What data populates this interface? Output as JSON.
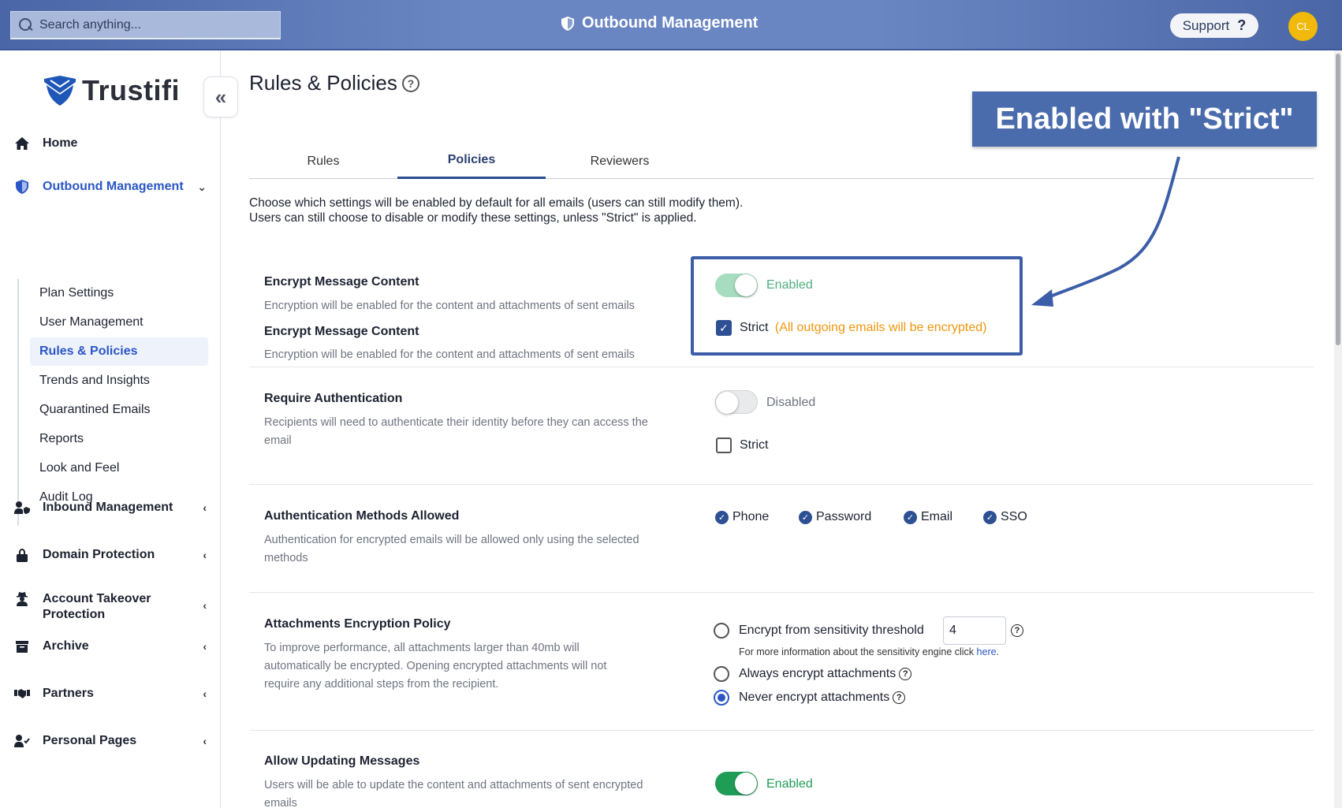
{
  "topbar": {
    "search_placeholder": "Search anything...",
    "title": "Outbound Management",
    "support_label": "Support",
    "support_icon": "?",
    "avatar_initials": "CL"
  },
  "sidebar": {
    "logo_text": "Trustifi",
    "collapse_icon": "«",
    "nav": [
      {
        "label": "Home",
        "icon": "home-icon"
      },
      {
        "label": "Outbound Management",
        "icon": "shield-icon"
      },
      {
        "label": "Inbound Management",
        "icon": "user-shield-icon"
      },
      {
        "label": "Domain Protection",
        "icon": "lock-icon"
      },
      {
        "label": "Account Takeover Protection",
        "icon": "user-secret-icon"
      },
      {
        "label": "Archive",
        "icon": "archive-icon"
      },
      {
        "label": "Partners",
        "icon": "handshake-icon"
      },
      {
        "label": "Personal Pages",
        "icon": "user-check-icon"
      }
    ],
    "submenu": [
      {
        "label": "Plan Settings"
      },
      {
        "label": "User Management"
      },
      {
        "label": "Rules & Policies"
      },
      {
        "label": "Trends and Insights"
      },
      {
        "label": "Quarantined Emails"
      },
      {
        "label": "Reports"
      },
      {
        "label": "Look and Feel"
      },
      {
        "label": "Audit Log"
      }
    ]
  },
  "main": {
    "page_title": "Rules & Policies",
    "tabs": [
      {
        "label": "Rules"
      },
      {
        "label": "Policies"
      },
      {
        "label": "Reviewers"
      }
    ],
    "intro_line1": "Choose which settings will be enabled by default for all emails (users can still modify them).",
    "intro_line2": "Users can still choose to disable or modify these settings, unless \"Strict\" is applied.",
    "encrypt": {
      "title": "Encrypt Message Content",
      "desc": "Encryption will be enabled for the content and attachments of sent emails",
      "toggle_label": "Enabled",
      "strict_label": "Strict",
      "strict_note": "(All outgoing emails will be encrypted)"
    },
    "auth": {
      "title": "Require Authentication",
      "desc": "Recipients will need to authenticate their identity before they can access the email",
      "toggle_label": "Disabled",
      "strict_label": "Strict"
    },
    "methods": {
      "title": "Authentication Methods Allowed",
      "desc": "Authentication for encrypted emails will be allowed only using the selected methods",
      "items": [
        {
          "label": "Phone"
        },
        {
          "label": "Password"
        },
        {
          "label": "Email"
        },
        {
          "label": "SSO"
        }
      ]
    },
    "attachments": {
      "title": "Attachments Encryption Policy",
      "desc": "To improve performance, all attachments larger than 40mb will automatically be encrypted. Opening encrypted attachments will not require any additional steps from the recipient.",
      "option1": "Encrypt from sensitivity threshold",
      "threshold_value": "4",
      "note_text": "For more information about the sensitivity engine click",
      "note_link": "here",
      "option2": "Always encrypt attachments",
      "option3": "Never encrypt attachments"
    },
    "updating": {
      "title": "Allow Updating Messages",
      "desc": "Users will be able to update the content and attachments of sent encrypted emails",
      "toggle_label": "Enabled"
    }
  },
  "annotation": {
    "callout_text": "Enabled with \"Strict\""
  },
  "colors": {
    "accent": "#2a56c6",
    "topbar": "#5a76b4",
    "enabled_green": "#1f9d57",
    "strict_note_orange": "#f0960e",
    "callout_blue": "#4a6cad"
  }
}
